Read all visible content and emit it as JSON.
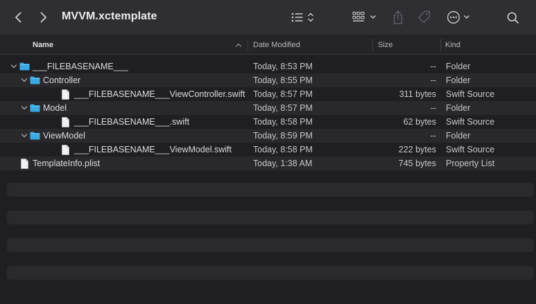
{
  "window": {
    "title": "MVVM.xctemplate"
  },
  "toolbar": {
    "back_icon": "chevron-left-icon",
    "forward_icon": "chevron-right-icon",
    "view_icon": "list-view-icon",
    "group_icon": "group-grid-icon",
    "share_icon": "share-icon",
    "tag_icon": "tag-icon",
    "more_icon": "ellipsis-circle-icon",
    "search_icon": "search-icon"
  },
  "columns": {
    "name": "Name",
    "date": "Date Modified",
    "size": "Size",
    "kind": "Kind"
  },
  "files": [
    {
      "name": "___FILEBASENAME___",
      "date": "Today, 8:53 PM",
      "size": "--",
      "kind": "Folder",
      "type": "folder",
      "depth": 0,
      "expanded": true
    },
    {
      "name": "Controller",
      "date": "Today, 8:55 PM",
      "size": "--",
      "kind": "Folder",
      "type": "folder",
      "depth": 1,
      "expanded": true
    },
    {
      "name": "___FILEBASENAME___ViewController.swift",
      "date": "Today, 8:57 PM",
      "size": "311 bytes",
      "kind": "Swift Source",
      "type": "file",
      "depth": 2
    },
    {
      "name": "Model",
      "date": "Today, 8:57 PM",
      "size": "--",
      "kind": "Folder",
      "type": "folder",
      "depth": 1,
      "expanded": true
    },
    {
      "name": "___FILEBASENAME___.swift",
      "date": "Today, 8:58 PM",
      "size": "62 bytes",
      "kind": "Swift Source",
      "type": "file",
      "depth": 2
    },
    {
      "name": "ViewModel",
      "date": "Today, 8:59 PM",
      "size": "--",
      "kind": "Folder",
      "type": "folder",
      "depth": 1,
      "expanded": true
    },
    {
      "name": "___FILEBASENAME___ViewModel.swift",
      "date": "Today, 8:58 PM",
      "size": "222 bytes",
      "kind": "Swift Source",
      "type": "file",
      "depth": 2
    },
    {
      "name": "TemplateInfo.plist",
      "date": "Today, 1:38 AM",
      "size": "745 bytes",
      "kind": "Property List",
      "type": "file",
      "depth": 0
    }
  ],
  "colors": {
    "folder": "#3aa8e4",
    "accent": "#3aa8e4"
  }
}
